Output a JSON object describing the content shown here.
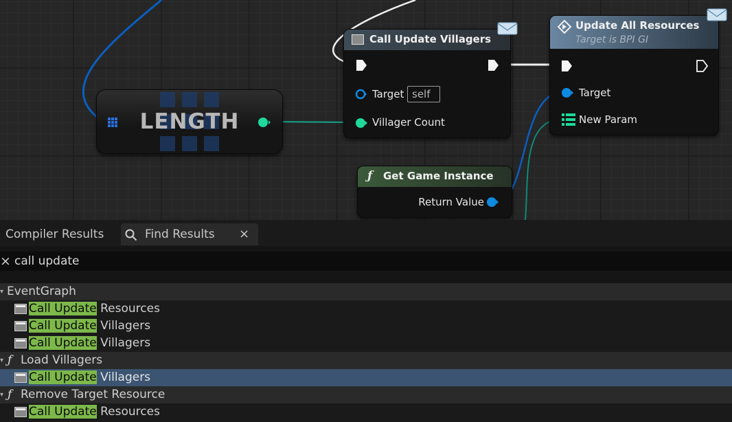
{
  "graph": {
    "length_node": {
      "label": "LENGTH"
    },
    "call_update_villagers": {
      "title": "Call Update Villagers",
      "target_label": "Target",
      "target_value": "self",
      "villager_count_label": "Villager Count"
    },
    "update_all_resources": {
      "title": "Update All Resources",
      "subtitle": "Target is BPI GI",
      "target_label": "Target",
      "new_param_label": "New Param"
    },
    "get_game_instance": {
      "title": "Get Game Instance",
      "return_value_label": "Return Value"
    },
    "colors": {
      "exec": "#ffffff",
      "object_pin": "#0d8be0",
      "int_pin": "#1ed99b",
      "array_pin": "#2a6fe0",
      "wire_blue": "#0a5fc0",
      "wire_teal": "#14a58a"
    }
  },
  "panel": {
    "tabs": [
      {
        "label": "Compiler Results"
      },
      {
        "label": "Find Results",
        "close": "×"
      }
    ],
    "search": {
      "query": "call update",
      "clear": "×"
    },
    "results": [
      {
        "type": "category",
        "label": "EventGraph"
      },
      {
        "type": "item",
        "highlight": "Call Update",
        "rest": " Resources"
      },
      {
        "type": "item",
        "highlight": "Call Update",
        "rest": " Villagers"
      },
      {
        "type": "item",
        "highlight": "Call Update",
        "rest": " Villagers"
      },
      {
        "type": "category",
        "label": "Load Villagers",
        "icon": "ƒ"
      },
      {
        "type": "item",
        "highlight": "Call Update",
        "rest": " Villagers",
        "selected": true
      },
      {
        "type": "category",
        "label": "Remove Target Resource",
        "icon": "ƒ"
      },
      {
        "type": "item",
        "highlight": "Call Update",
        "rest": " Resources"
      }
    ],
    "colors": {
      "highlight": "#7db84a",
      "selected_row": "#3b5472"
    }
  }
}
